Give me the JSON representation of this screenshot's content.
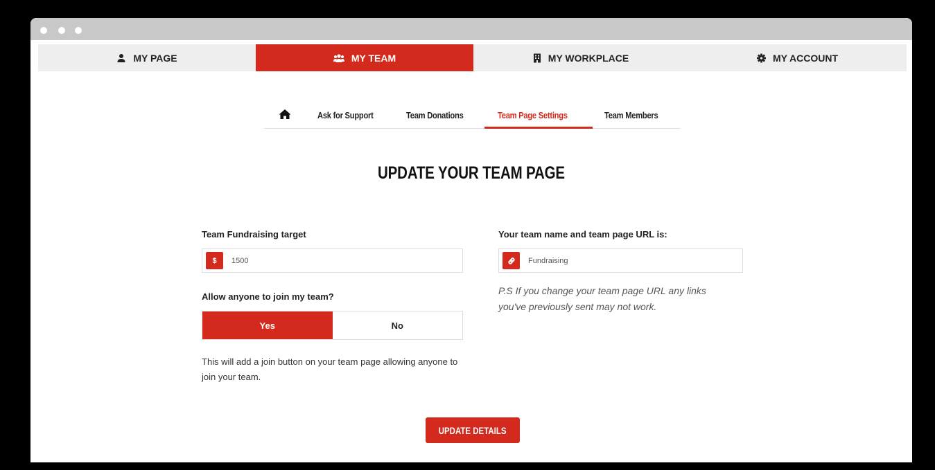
{
  "main_nav": {
    "items": [
      {
        "label": "MY PAGE",
        "icon": "user-icon",
        "active": false
      },
      {
        "label": "MY TEAM",
        "icon": "users-icon",
        "active": true
      },
      {
        "label": "MY WORKPLACE",
        "icon": "building-icon",
        "active": false
      },
      {
        "label": "MY ACCOUNT",
        "icon": "gear-icon",
        "active": false
      }
    ]
  },
  "sub_nav": {
    "home_icon": "home-icon",
    "items": [
      {
        "label": "Ask for Support",
        "active": false
      },
      {
        "label": "Team Donations",
        "active": false
      },
      {
        "label": "Team Page Settings",
        "active": true
      },
      {
        "label": "Team Members",
        "active": false
      }
    ]
  },
  "page_title": "UPDATE YOUR TEAM PAGE",
  "form": {
    "target_label": "Team Fundraising target",
    "target_prefix": "$",
    "target_value": "1500",
    "join_label": "Allow anyone to join my team?",
    "join_yes": "Yes",
    "join_no": "No",
    "join_selected": "Yes",
    "join_help": "This will add a join button on your team page allowing anyone to join your team.",
    "url_label": "Your team name and team page URL is:",
    "url_icon": "link-icon",
    "url_value": "Fundraising",
    "url_note": "P.S If you change your team page URL any links you've previously sent may not work.",
    "submit_label": "UPDATE DETAILS"
  },
  "colors": {
    "accent": "#d42a1d",
    "nav_bg": "#eeeeee",
    "titlebar": "#c8c8c8"
  }
}
